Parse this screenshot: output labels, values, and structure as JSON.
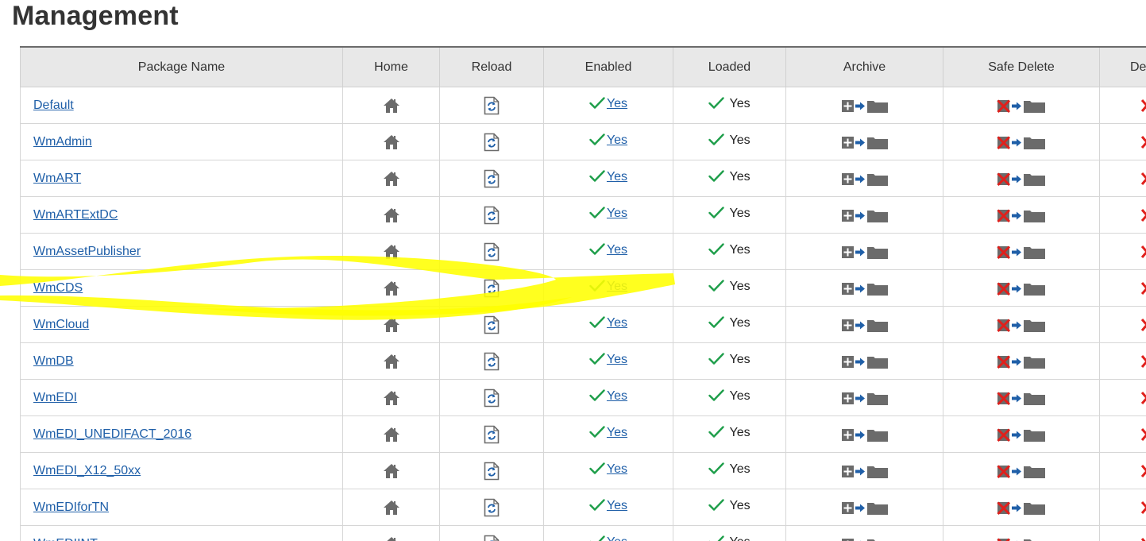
{
  "page": {
    "title": "Management"
  },
  "table": {
    "columns": [
      "Package Name",
      "Home",
      "Reload",
      "Enabled",
      "Loaded",
      "Archive",
      "Safe Delete",
      "De"
    ],
    "rows": [
      {
        "name": "Default",
        "enabled": "Yes",
        "loaded": "Yes"
      },
      {
        "name": "WmAdmin",
        "enabled": "Yes",
        "loaded": "Yes"
      },
      {
        "name": "WmART",
        "enabled": "Yes",
        "loaded": "Yes"
      },
      {
        "name": "WmARTExtDC",
        "enabled": "Yes",
        "loaded": "Yes"
      },
      {
        "name": "WmAssetPublisher",
        "enabled": "Yes",
        "loaded": "Yes"
      },
      {
        "name": "WmCDS",
        "enabled": "Yes",
        "loaded": "Yes"
      },
      {
        "name": "WmCloud",
        "enabled": "Yes",
        "loaded": "Yes"
      },
      {
        "name": "WmDB",
        "enabled": "Yes",
        "loaded": "Yes"
      },
      {
        "name": "WmEDI",
        "enabled": "Yes",
        "loaded": "Yes"
      },
      {
        "name": "WmEDI_UNEDIFACT_2016",
        "enabled": "Yes",
        "loaded": "Yes"
      },
      {
        "name": "WmEDI_X12_50xx",
        "enabled": "Yes",
        "loaded": "Yes"
      },
      {
        "name": "WmEDIforTN",
        "enabled": "Yes",
        "loaded": "Yes"
      },
      {
        "name": "WmEDIINT",
        "enabled": "Yes",
        "loaded": "Yes"
      }
    ]
  },
  "icons": {
    "home": "home-icon",
    "reload": "reload-icon",
    "enabled_check": "check-icon",
    "archive": "archive-icon",
    "safe_delete": "safe-delete-icon",
    "delete": "delete-icon"
  },
  "colors": {
    "link": "#1f5fa8",
    "check": "#1e9e4a",
    "header_bg": "#e8e8e8",
    "icon_gray": "#6b6b6b",
    "archive_arrow": "#1f5fa8",
    "delete_red": "#e0201c",
    "highlight": "#ffff00"
  }
}
